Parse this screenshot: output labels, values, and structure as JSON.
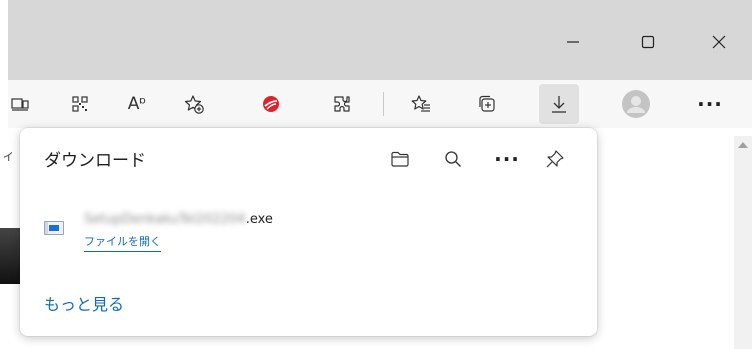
{
  "window": {
    "controls": [
      {
        "name": "minimize-button",
        "icon": "minimize-icon"
      },
      {
        "name": "maximize-button",
        "icon": "maximize-icon"
      },
      {
        "name": "close-button",
        "icon": "close-icon"
      }
    ]
  },
  "toolbar": {
    "icons": [
      "immersive-reader-icon",
      "qr-code-icon",
      "read-aloud-icon",
      "add-favorite-icon",
      "trend-micro-extension-icon",
      "extensions-icon",
      "favorites-icon",
      "collections-icon",
      "downloads-icon",
      "profile-avatar-icon",
      "more-menu-icon"
    ],
    "read_aloud_label": "Aᶛ"
  },
  "page": {
    "left_cut_text": "ィ"
  },
  "downloads": {
    "title": "ダウンロード",
    "actions": [
      "open-folder-icon",
      "search-icon",
      "more-options-icon",
      "pin-icon"
    ],
    "more_dots": "···",
    "item": {
      "filename_blurred": "SetupDenkakuTel202204",
      "filename_ext": ".exe",
      "open_label": "ファイルを開く"
    },
    "see_more": "もっと見る"
  },
  "colors": {
    "accent": "#0f6cbd",
    "trend_micro_red": "#e0222d",
    "titlebar": "#d7d7d7"
  }
}
